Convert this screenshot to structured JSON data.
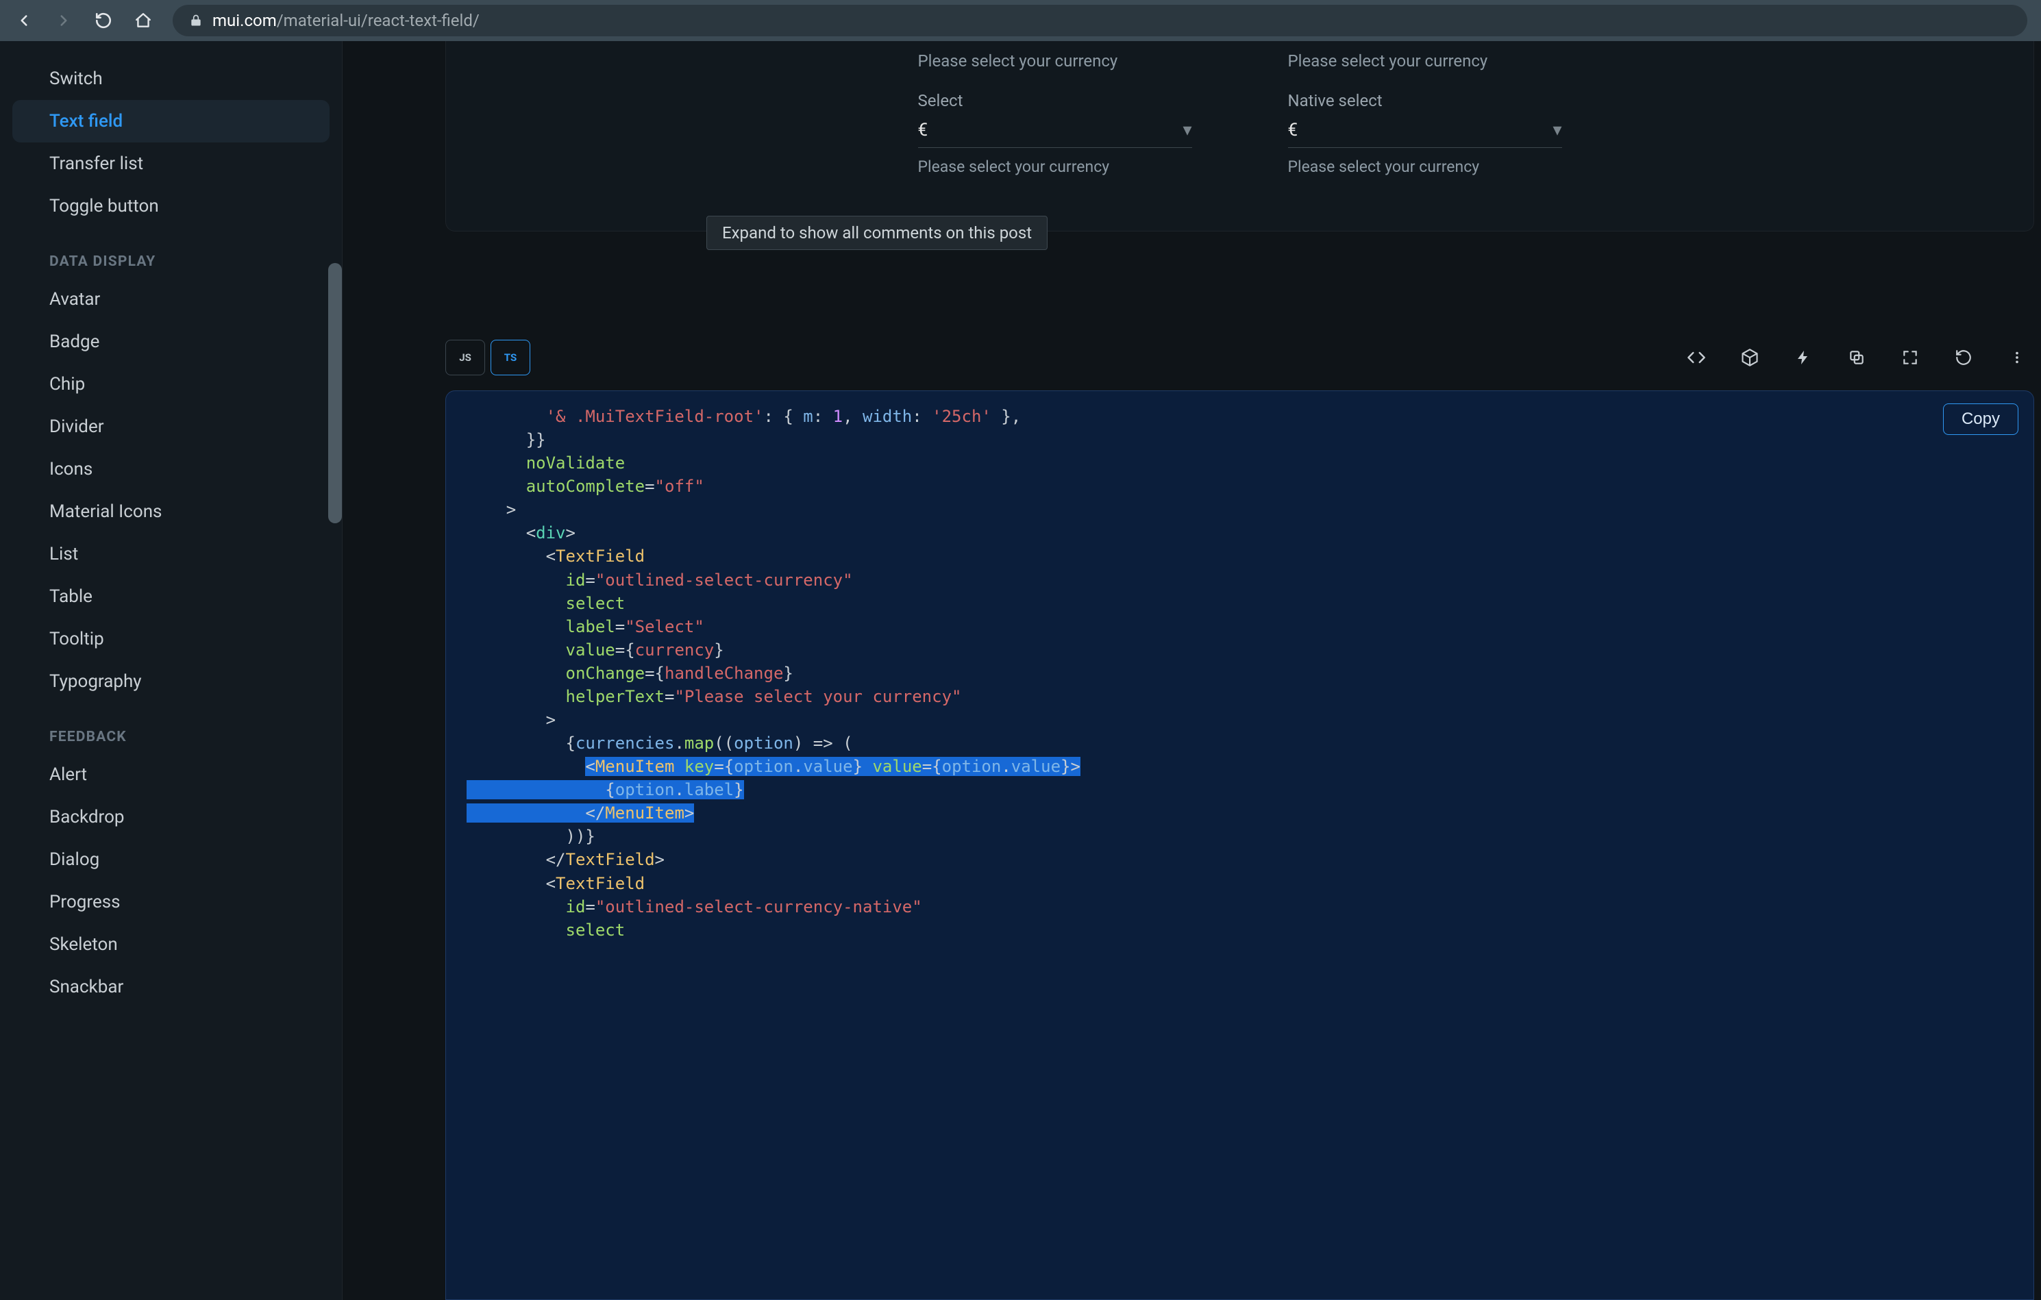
{
  "browser": {
    "url_domain": "mui.com",
    "url_path": "/material-ui/react-text-field/"
  },
  "sidebar": {
    "items_top": [
      "Switch"
    ],
    "active": "Text field",
    "items_after_active": [
      "Transfer list",
      "Toggle button"
    ],
    "sections": [
      {
        "title": "DATA DISPLAY",
        "items": [
          "Avatar",
          "Badge",
          "Chip",
          "Divider",
          "Icons",
          "Material Icons",
          "List",
          "Table",
          "Tooltip",
          "Typography"
        ]
      },
      {
        "title": "FEEDBACK",
        "items": [
          "Alert",
          "Backdrop",
          "Dialog",
          "Progress",
          "Skeleton",
          "Snackbar"
        ]
      }
    ]
  },
  "demo": {
    "helper_top": "Please select your currency",
    "col1": {
      "label": "Select",
      "value": "€",
      "helper": "Please select your currency"
    },
    "col2": {
      "label": "Native select",
      "value": "€",
      "helper": "Please select your currency"
    },
    "expand_tip": "Expand to show all comments on this post"
  },
  "toolbar": {
    "lang_js": "JS",
    "lang_ts": "TS",
    "copy": "Copy"
  },
  "code": {
    "l1a": "'& .MuiTextField-root'",
    "l1b": ": { ",
    "l1c": "m",
    "l1d": ": ",
    "l1e": "1",
    "l1f": ", ",
    "l1g": "width",
    "l1h": ": ",
    "l1i": "'25ch'",
    "l1j": " },",
    "l2": "}}",
    "l3": "noValidate",
    "l4a": "autoComplete",
    "l4b": "=",
    "l4c": "\"off\"",
    "l5": ">",
    "l6a": "<",
    "l6b": "div",
    "l6c": ">",
    "l7a": "<",
    "l7b": "TextField",
    "l8a": "id",
    "l8b": "=",
    "l8c": "\"outlined-select-currency\"",
    "l9": "select",
    "l10a": "label",
    "l10b": "=",
    "l10c": "\"Select\"",
    "l11a": "value",
    "l11b": "=",
    "l11c": "{",
    "l11d": "currency",
    "l11e": "}",
    "l12a": "onChange",
    "l12b": "=",
    "l12c": "{",
    "l12d": "handleChange",
    "l12e": "}",
    "l13a": "helperText",
    "l13b": "=",
    "l13c": "\"Please select your currency\"",
    "l14": ">",
    "l15a": "{",
    "l15b": "currencies",
    "l15c": ".",
    "l15d": "map",
    "l15e": "((",
    "l15f": "option",
    "l15g": ") ",
    "l15h": "=>",
    "l15i": " (",
    "l16a": "<",
    "l16b": "MenuItem",
    "l16sp1": " ",
    "l16c": "key",
    "l16d": "=",
    "l16e": "{",
    "l16f": "option",
    "l16g": ".",
    "l16h": "value",
    "l16i": "}",
    "l16sp2": " ",
    "l16j": "value",
    "l16k": "=",
    "l16l": "{",
    "l16m": "option",
    "l16n": ".",
    "l16o": "value",
    "l16p": "}",
    "l16q": ">",
    "l17a": "{",
    "l17b": "option",
    "l17c": ".",
    "l17d": "label",
    "l17e": "}",
    "l18a": "</",
    "l18b": "MenuItem",
    "l18c": ">",
    "l19": "))}",
    "l20a": "</",
    "l20b": "TextField",
    "l20c": ">",
    "l21a": "<",
    "l21b": "TextField",
    "l22a": "id",
    "l22b": "=",
    "l22c": "\"outlined-select-currency-native\"",
    "l23": "select"
  }
}
